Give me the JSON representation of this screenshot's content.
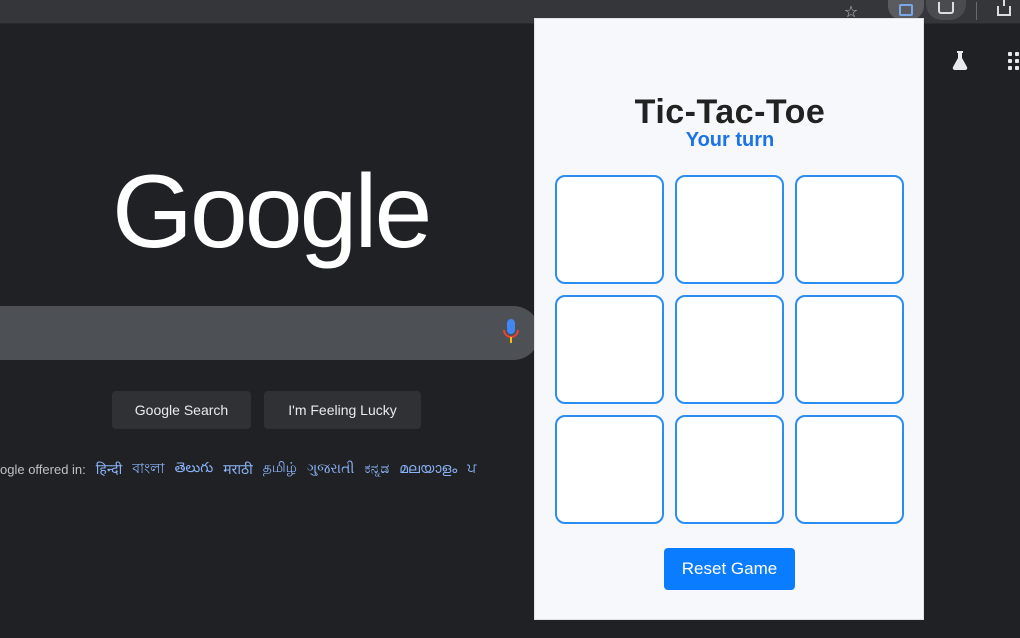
{
  "browser": {
    "toolbar_icons": [
      "star-icon",
      "extension-icon",
      "share-icon",
      "download-icon"
    ]
  },
  "google": {
    "logo_text": "Google",
    "buttons": {
      "search": "Google Search",
      "lucky": "I'm Feeling Lucky"
    },
    "offered_in_prefix": "ogle offered in:",
    "languages": [
      "हिन्दी",
      "বাংলা",
      "తెలుగు",
      "मराठी",
      "தமிழ்",
      "ગુજરાતી",
      "ಕನ್ನಡ",
      "മലയാളം",
      "ਪ"
    ],
    "icons": [
      "labs-icon",
      "apps-icon",
      "mic-icon"
    ]
  },
  "popup": {
    "title": "Tic-Tac-Toe",
    "status": "Your turn",
    "board": [
      "",
      "",
      "",
      "",
      "",
      "",
      "",
      "",
      ""
    ],
    "reset_label": "Reset Game",
    "accent_color": "#0a7cff"
  }
}
